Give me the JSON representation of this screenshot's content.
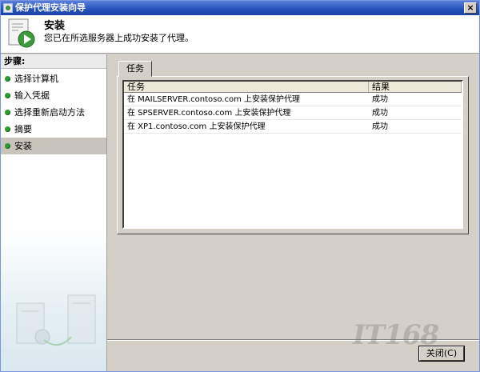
{
  "window": {
    "title": "保护代理安装向导",
    "close_glyph": "×"
  },
  "header": {
    "title": "安装",
    "subtitle": "您已在所选服务器上成功安装了代理。",
    "icon": "install-wizard-icon"
  },
  "sidebar": {
    "heading": "步骤:",
    "items": [
      {
        "label": "选择计算机",
        "active": false
      },
      {
        "label": "输入凭据",
        "active": false
      },
      {
        "label": "选择重新启动方法",
        "active": false
      },
      {
        "label": "摘要",
        "active": false
      },
      {
        "label": "安装",
        "active": true
      }
    ]
  },
  "tabs": [
    {
      "label": "任务"
    }
  ],
  "table": {
    "columns": [
      "任务",
      "结果"
    ],
    "rows": [
      {
        "task": "在 MAILSERVER.contoso.com 上安装保护代理",
        "result": "成功"
      },
      {
        "task": "在 SPSERVER.contoso.com 上安装保护代理",
        "result": "成功"
      },
      {
        "task": "在 XP1.contoso.com 上安装保护代理",
        "result": "成功"
      }
    ]
  },
  "footer": {
    "close_label": "关闭(C)"
  },
  "watermark": "IT168",
  "colors": {
    "titlebar": "#2452b8",
    "step_dot": "#2e9a2e",
    "active_step": "#c8c4bc"
  }
}
